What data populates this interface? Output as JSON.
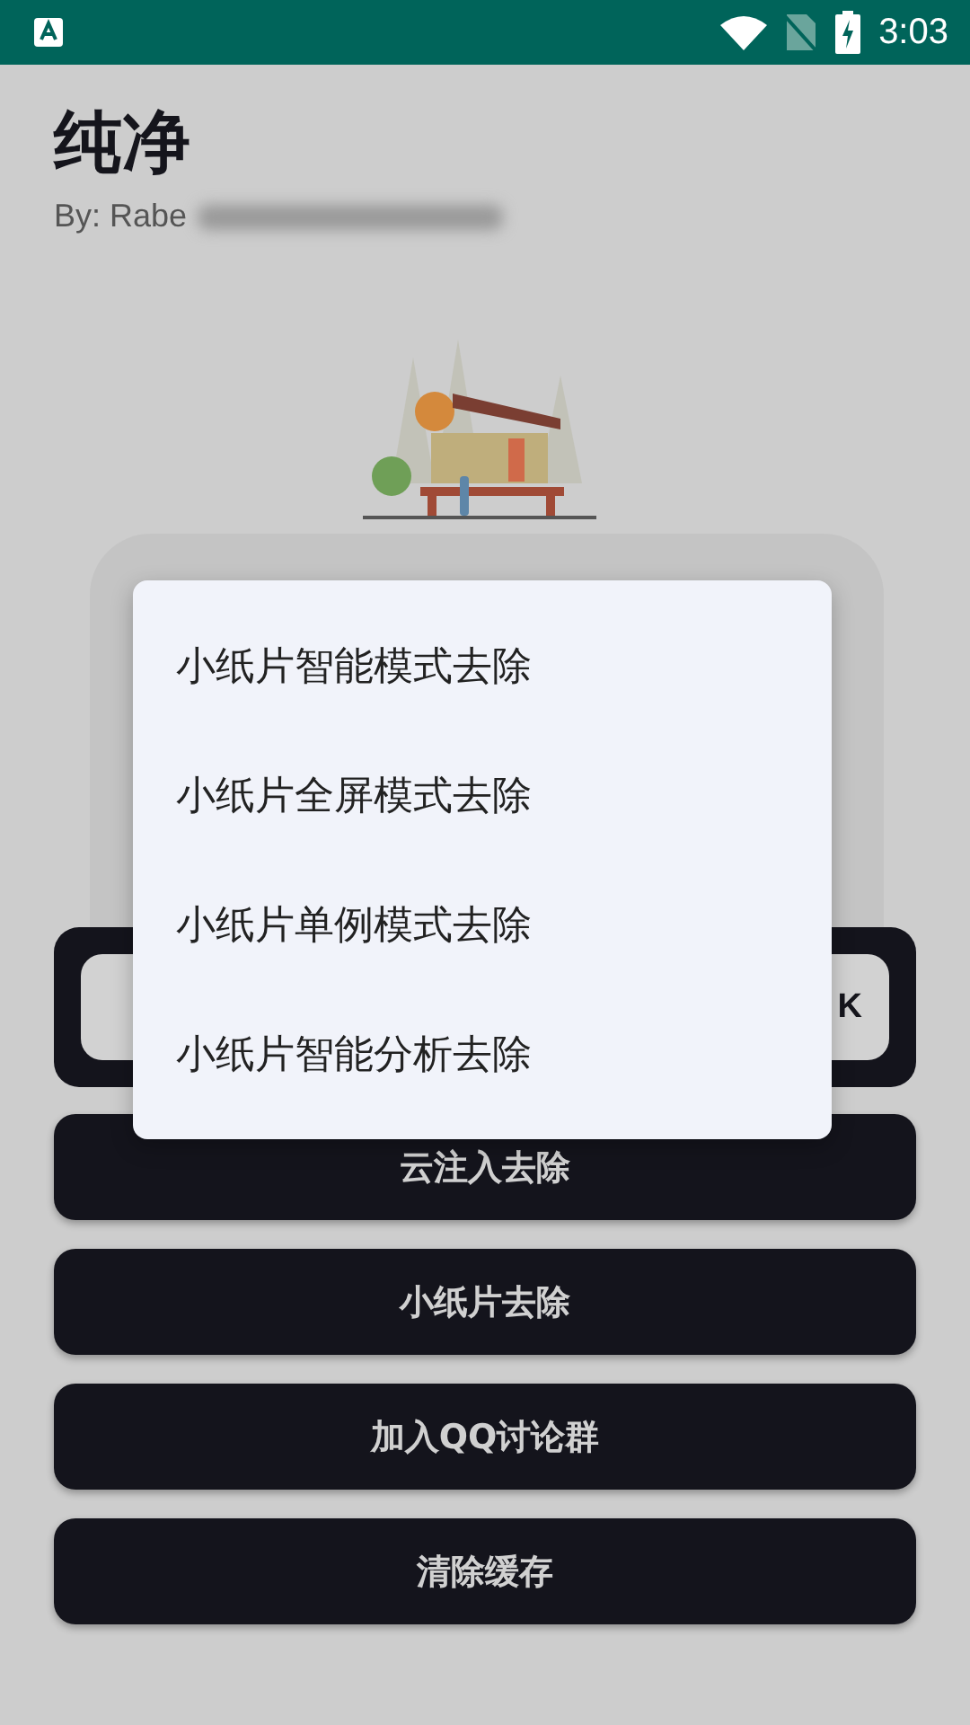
{
  "status_bar": {
    "time": "3:03"
  },
  "header": {
    "title": "纯净",
    "subtitle": "By: Rabe"
  },
  "panel_button": {
    "label": "K"
  },
  "popup_menu": {
    "items": [
      {
        "label": "小纸片智能模式去除"
      },
      {
        "label": "小纸片全屏模式去除"
      },
      {
        "label": "小纸片单例模式去除"
      },
      {
        "label": "小纸片智能分析去除"
      }
    ]
  },
  "buttons": [
    {
      "label": "云注入去除"
    },
    {
      "label": "小纸片去除"
    },
    {
      "label": "加入QQ讨论群"
    },
    {
      "label": "清除缓存"
    }
  ]
}
